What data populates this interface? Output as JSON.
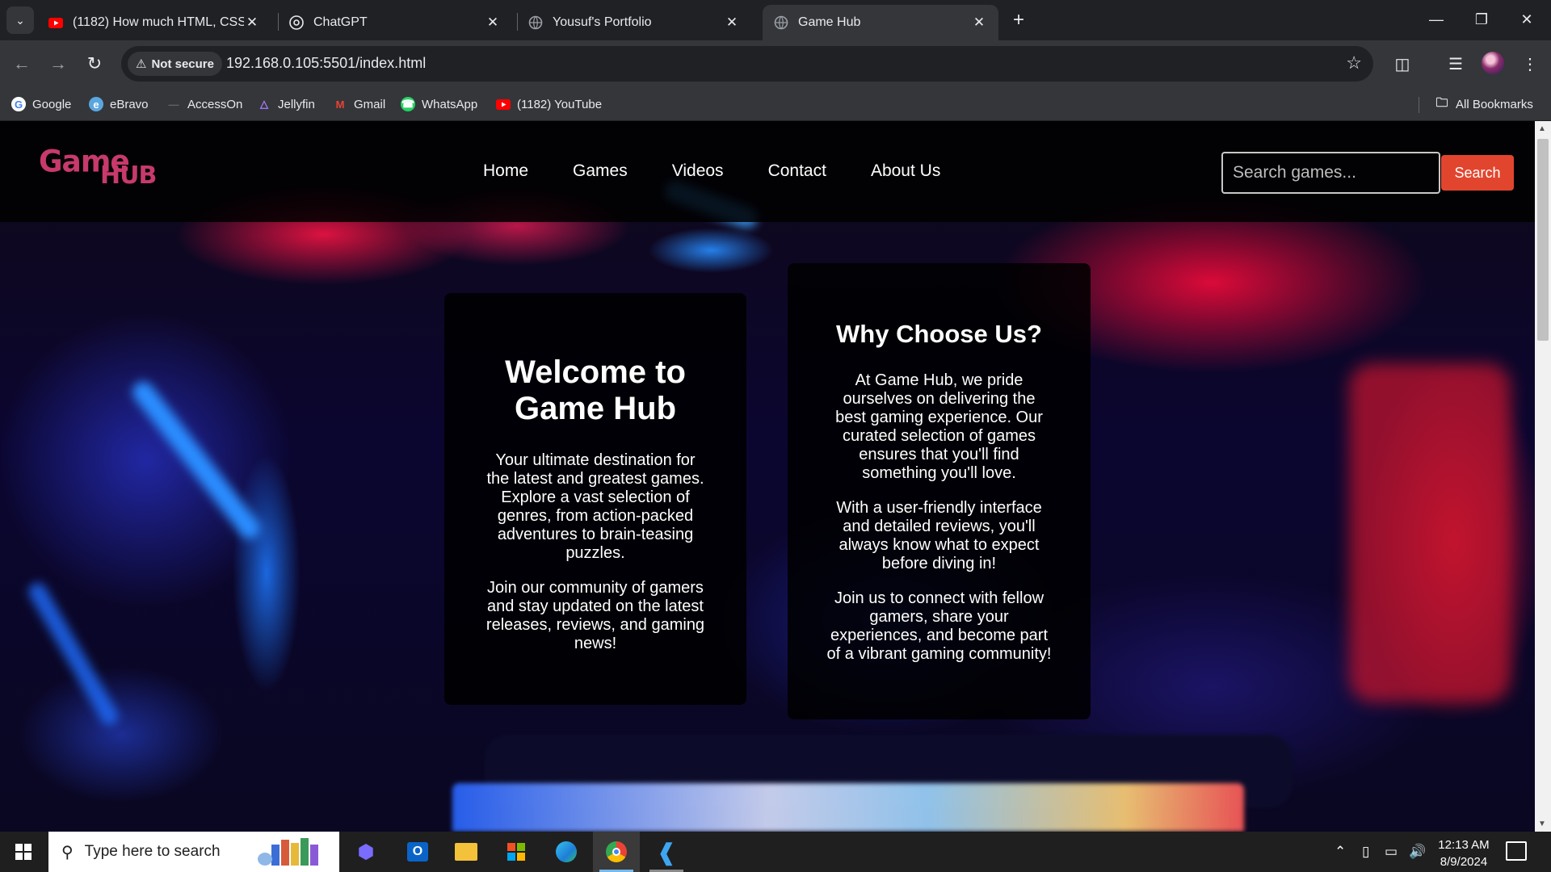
{
  "browser": {
    "tabs": [
      {
        "title": "(1182) How much HTML, CSS and",
        "icon": "youtube-icon",
        "active": false
      },
      {
        "title": "ChatGPT",
        "icon": "chatgpt-icon",
        "active": false
      },
      {
        "title": "Yousuf's Portfolio",
        "icon": "globe-icon",
        "active": false
      },
      {
        "title": "Game Hub",
        "icon": "globe-icon",
        "active": true
      }
    ],
    "security_label": "Not secure",
    "url": "192.168.0.105:5501/index.html",
    "bookmarks": [
      {
        "label": "Google",
        "icon": "google-icon"
      },
      {
        "label": "eBravo",
        "icon": "ebravo-icon"
      },
      {
        "label": "AccessOn",
        "icon": "accesson-icon"
      },
      {
        "label": "Jellyfin",
        "icon": "jellyfin-icon"
      },
      {
        "label": "Gmail",
        "icon": "gmail-icon"
      },
      {
        "label": "WhatsApp",
        "icon": "whatsapp-icon"
      },
      {
        "label": "(1182) YouTube",
        "icon": "youtube-icon"
      }
    ],
    "all_bookmarks_label": "All Bookmarks"
  },
  "site": {
    "logo_part1": "Game",
    "logo_part2": "HUB",
    "nav": [
      "Home",
      "Games",
      "Videos",
      "Contact",
      "About Us"
    ],
    "search_placeholder": "Search games...",
    "search_button": "Search",
    "welcome": {
      "title": "Welcome to Game Hub",
      "paragraphs": [
        "Your ultimate destination for the latest and greatest games. Explore a vast selection of genres, from action-packed adventures to brain-teasing puzzles.",
        "Join our community of gamers and stay updated on the latest releases, reviews, and gaming news!"
      ]
    },
    "why": {
      "title": "Why Choose Us?",
      "paragraphs": [
        "At Game Hub, we pride ourselves on delivering the best gaming experience. Our curated selection of games ensures that you'll find something you'll love.",
        "With a user-friendly interface and detailed reviews, you'll always know what to expect before diving in!",
        "Join us to connect with fellow gamers, share your experiences, and become part of a vibrant gaming community!"
      ]
    }
  },
  "taskbar": {
    "search_placeholder": "Type here to search",
    "time": "12:13 AM",
    "date": "8/9/2024"
  },
  "colors": {
    "logo": "#c73a6b",
    "search_button": "#e2452e",
    "chrome_dark": "#202124",
    "chrome_toolbar": "#35363a"
  }
}
